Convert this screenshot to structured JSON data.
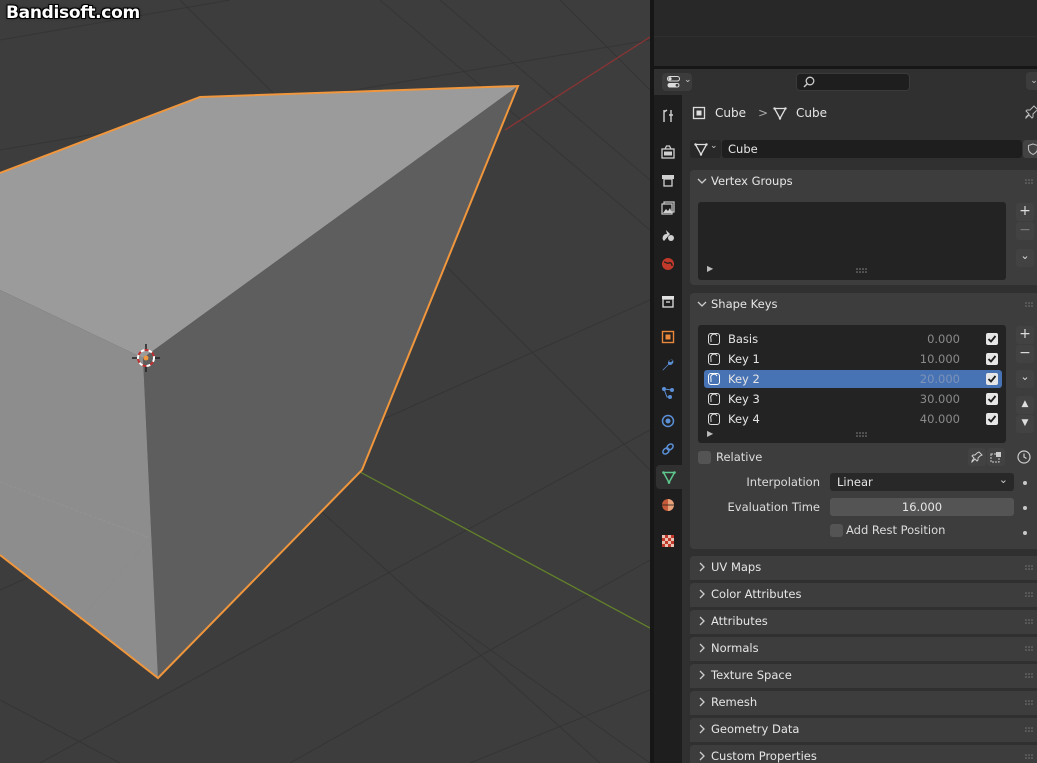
{
  "watermark": "Bandisoft.com",
  "colors": {
    "viewport_bg": "#3d3d3d",
    "selection_outline": "#f0963c",
    "x_axis": "#a03a3a",
    "y_axis": "#6e8c2c",
    "selected_row": "#4772b3",
    "active_tab_icon": "#5ec78e"
  },
  "properties": {
    "breadcrumb": {
      "object": "Cube",
      "separator": ">",
      "mesh": "Cube"
    },
    "mesh_name": "Cube",
    "tabs": [
      "tool-icon",
      "render-icon",
      "output-icon",
      "view-layer-icon",
      "scene-icon",
      "world-icon",
      "collection-icon",
      "object-icon",
      "modifier-icon",
      "particles-icon",
      "physics-icon",
      "constraints-icon",
      "data-icon",
      "material-icon",
      "texture-icon"
    ],
    "vertex_groups": {
      "title": "Vertex Groups",
      "add": "+",
      "remove": "−",
      "menu": "⌄"
    },
    "shape_keys": {
      "title": "Shape Keys",
      "keys": [
        {
          "name": "Basis",
          "value": "0.000",
          "selected": false
        },
        {
          "name": "Key 1",
          "value": "10.000",
          "selected": false
        },
        {
          "name": "Key 2",
          "value": "20.000",
          "selected": true
        },
        {
          "name": "Key 3",
          "value": "30.000",
          "selected": false
        },
        {
          "name": "Key 4",
          "value": "40.000",
          "selected": false
        }
      ],
      "relative_label": "Relative",
      "relative_checked": false,
      "interpolation_label": "Interpolation",
      "interpolation_value": "Linear",
      "evaluation_time_label": "Evaluation Time",
      "evaluation_time_value": "16.000",
      "add_rest_position_label": "Add Rest Position",
      "add_rest_position_checked": false
    },
    "collapsed_panels": [
      "UV Maps",
      "Color Attributes",
      "Attributes",
      "Normals",
      "Texture Space",
      "Remesh",
      "Geometry Data",
      "Custom Properties"
    ]
  }
}
